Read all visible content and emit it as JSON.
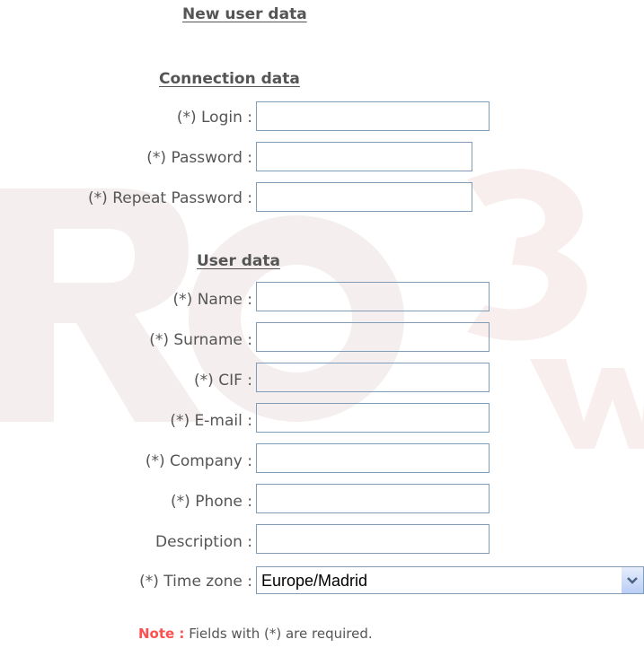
{
  "headings": {
    "main": "New user data",
    "connection": "Connection data",
    "user": "User data"
  },
  "connection_fields": {
    "login_label": "(*) Login :",
    "login_value": "",
    "password_label": "(*) Password :",
    "password_value": "",
    "repeat_password_label": "(*) Repeat Password :",
    "repeat_password_value": ""
  },
  "user_fields": {
    "name_label": "(*) Name :",
    "name_value": "",
    "surname_label": "(*) Surname :",
    "surname_value": "",
    "cif_label": "(*) CIF :",
    "cif_value": "",
    "email_label": "(*) E-mail :",
    "email_value": "",
    "company_label": "(*) Company :",
    "company_value": "",
    "phone_label": "(*) Phone :",
    "phone_value": "",
    "description_label": "Description :",
    "description_value": "",
    "timezone_label": "(*) Time zone :",
    "timezone_value": "Europe/Madrid"
  },
  "note": {
    "key": "Note :",
    "text": "Fields with (*) are required."
  },
  "colors": {
    "input_border": "#7f9db9",
    "note_key": "#ff5050",
    "watermark": "#f3e9e9"
  },
  "icons": {
    "dropdown": "chevron-down-icon",
    "background": "watermark-logo"
  }
}
